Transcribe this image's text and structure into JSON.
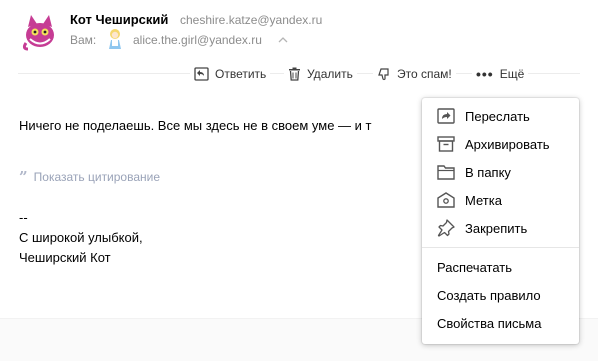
{
  "header": {
    "sender_name": "Кот Чеширский",
    "sender_email": "cheshire.katze@yandex.ru",
    "to_label": "Вам:",
    "to_email": "alice.the.girl@yandex.ru"
  },
  "toolbar": {
    "reply_label": "Ответить",
    "delete_label": "Удалить",
    "spam_label": "Это спам!",
    "more_dots": "•••",
    "more_label": "Ещё"
  },
  "message": {
    "body": "Ничего не поделаешь. Все мы здесь не в своем уме — и т",
    "show_quote_label": "Показать цитирование",
    "quote_mark": "”",
    "signature": [
      "--",
      "С широкой улыбкой,",
      "Чеширский Кот"
    ]
  },
  "dropdown": {
    "items": [
      {
        "label": "Переслать",
        "icon": "forward-icon"
      },
      {
        "label": "Архивировать",
        "icon": "archive-icon"
      },
      {
        "label": "В папку",
        "icon": "folder-icon"
      },
      {
        "label": "Метка",
        "icon": "label-icon"
      },
      {
        "label": "Закрепить",
        "icon": "pin-icon"
      }
    ],
    "text_items": [
      {
        "label": "Распечатать"
      },
      {
        "label": "Создать правило"
      },
      {
        "label": "Свойства письма"
      }
    ]
  },
  "colors": {
    "text_muted": "#8c8c8c",
    "link_muted": "#9aa3b8",
    "avatar_cat": "#c63c94"
  }
}
